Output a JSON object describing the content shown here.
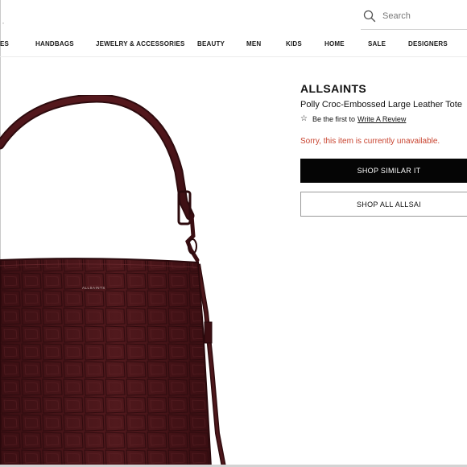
{
  "header": {
    "search": {
      "placeholder": "Search",
      "value": ""
    },
    "nav": [
      {
        "label": "DES"
      },
      {
        "label": "HANDBAGS"
      },
      {
        "label": "JEWELRY & ACCESSORIES"
      },
      {
        "label": "BEAUTY"
      },
      {
        "label": "MEN"
      },
      {
        "label": "KIDS"
      },
      {
        "label": "HOME"
      },
      {
        "label": "SALE"
      },
      {
        "label": "DESIGNERS"
      }
    ]
  },
  "product": {
    "image_logo_text": "ALLSAINTS",
    "brand": "ALLSAINTS",
    "title": "Polly Croc-Embossed Large Leather Tote",
    "review": {
      "prefix": "Be the first to",
      "link": "Write A Review"
    },
    "status": "Sorry, this item is currently unavailable.",
    "buttons": {
      "shop_similar": "SHOP SIMILAR IT",
      "shop_all": "SHOP ALL ALLSAI"
    }
  },
  "colors": {
    "leather": "#4a1519",
    "button_dark": "#050505",
    "error_text": "#c8432f"
  },
  "icons": {
    "search": "search-icon",
    "star": "star-outline-icon"
  }
}
